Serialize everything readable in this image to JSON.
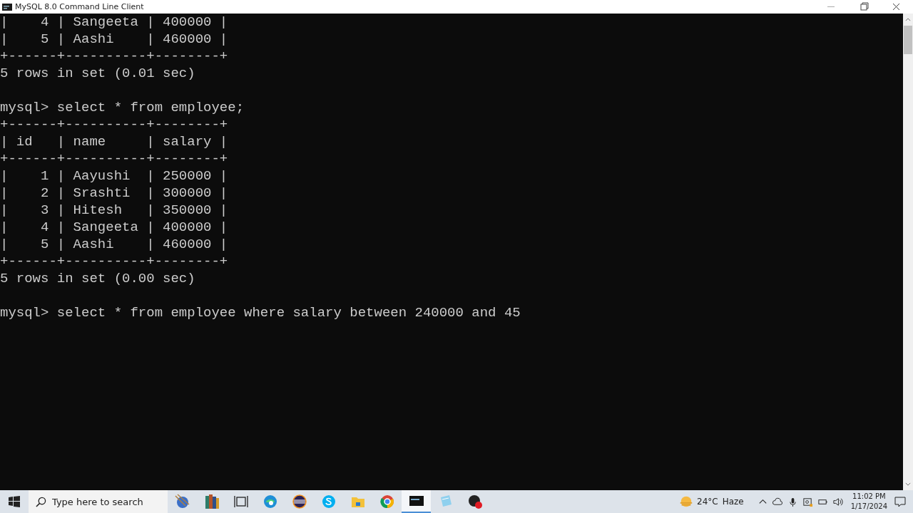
{
  "window": {
    "title": "MySQL 8.0 Command Line Client"
  },
  "terminal": {
    "blocks": [
      [
        "|    4 | Sangeeta | 400000 |",
        "|    5 | Aashi    | 460000 |",
        "+------+----------+--------+",
        "5 rows in set (0.01 sec)"
      ],
      [
        "mysql> select * from employee;",
        "+------+----------+--------+",
        "| id   | name     | salary |",
        "+------+----------+--------+",
        "|    1 | Aayushi  | 250000 |",
        "|    2 | Srashti  | 300000 |",
        "|    3 | Hitesh   | 350000 |",
        "|    4 | Sangeeta | 400000 |",
        "|    5 | Aashi    | 460000 |",
        "+------+----------+--------+",
        "5 rows in set (0.00 sec)"
      ],
      [
        "mysql> select * from employee where salary between 240000 and 45"
      ]
    ]
  },
  "taskbar": {
    "search": {
      "placeholder": "Type here to search"
    },
    "apps": [
      {
        "kind": "yarn",
        "active": false
      },
      {
        "kind": "books",
        "active": false
      },
      {
        "kind": "taskview",
        "active": false
      },
      {
        "kind": "edge",
        "active": false
      },
      {
        "kind": "eclipse",
        "active": false
      },
      {
        "kind": "skype",
        "active": false
      },
      {
        "kind": "folder",
        "active": false
      },
      {
        "kind": "chrome",
        "active": false
      },
      {
        "kind": "terminal",
        "active": true
      },
      {
        "kind": "notepad",
        "active": false
      },
      {
        "kind": "record",
        "active": false
      }
    ],
    "weather": {
      "temp": "24°C",
      "condition": "Haze"
    },
    "time": "11:02 PM",
    "date": "1/17/2024"
  }
}
